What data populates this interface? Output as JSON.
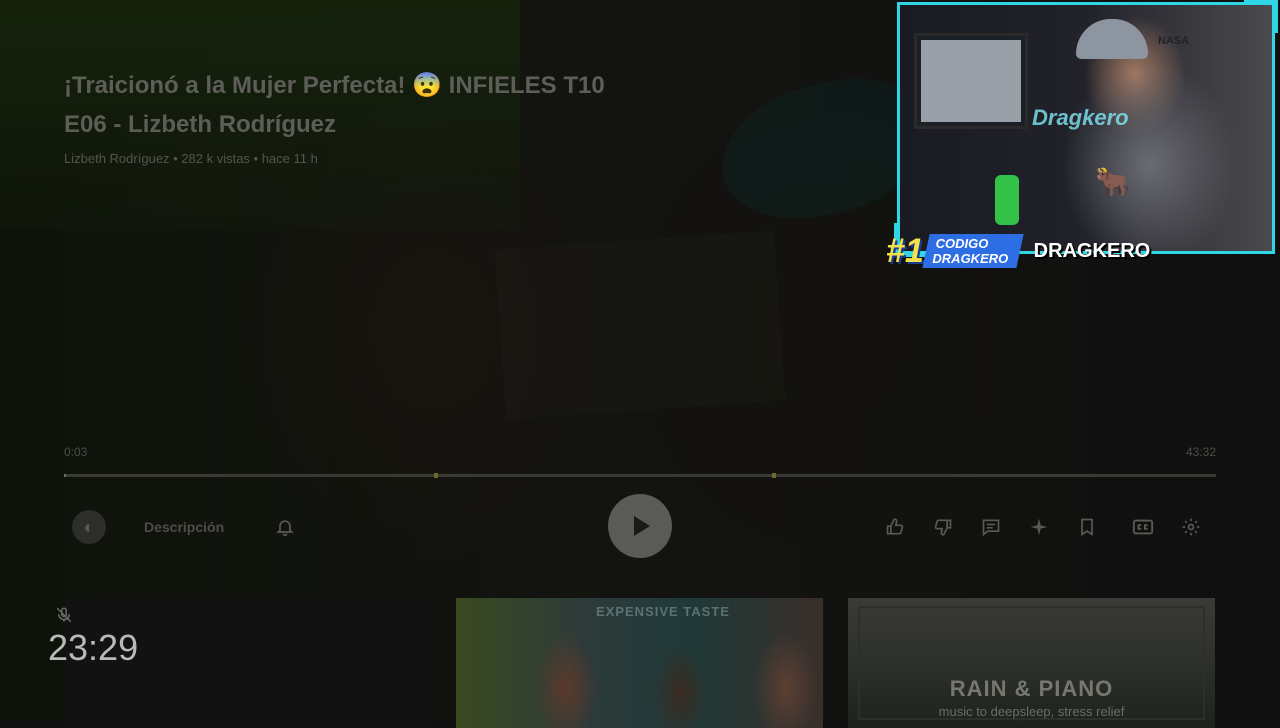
{
  "video": {
    "title": "¡Traicionó a la Mujer Perfecta! 😨 INFIELES T10 E06 - Lizbeth Rodríguez",
    "meta": "Lizbeth Rodríguez • 282 k vistas • hace 11 h",
    "time_current": "0:03",
    "time_total": "43:32",
    "progress_fraction": 0.001
  },
  "controls": {
    "description_label": "Descripción",
    "icons": [
      "notifications-icon",
      "play-icon",
      "like-icon",
      "dislike-icon",
      "comments-icon",
      "ask-ai-icon",
      "save-icon",
      "captions-icon",
      "settings-icon"
    ]
  },
  "thumbnails": {
    "second_caption": "EXPENSIVE TASTE",
    "third_title": "RAIN & PIANO",
    "third_subtitle": "music to deepsleep, stress relief"
  },
  "overlay": {
    "clock": "23:29",
    "mic_status_icon": "mic-muted-icon",
    "streamer_name": "DRAGKERO",
    "code_rank": "#1",
    "code_line1": "CODIGO",
    "code_line2": "DRAGKERO",
    "cam_sign": "Dragkero",
    "cap_brand": "NASA",
    "accent_color": "#2fd7e6"
  }
}
